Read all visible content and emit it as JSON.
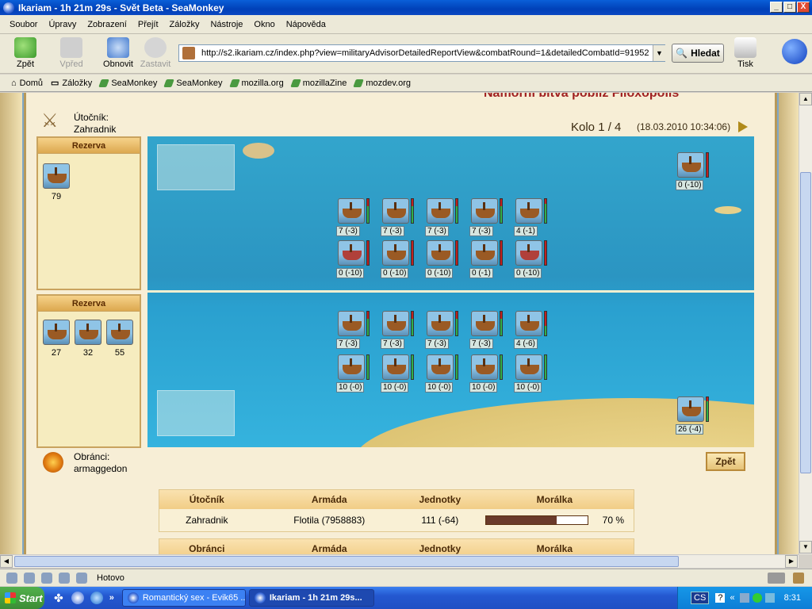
{
  "window": {
    "title": "Ikariam - 1h 21m 29s - Svět Beta - SeaMonkey",
    "buttons": {
      "minimize": "_",
      "maximize": "□",
      "close": "X"
    }
  },
  "menu": [
    "Soubor",
    "Úpravy",
    "Zobrazení",
    "Přejít",
    "Záložky",
    "Nástroje",
    "Okno",
    "Nápověda"
  ],
  "nav": {
    "back": "Zpět",
    "forward": "Vpřed",
    "reload": "Obnovit",
    "stop": "Zastavit",
    "url": "http://s2.ikariam.cz/index.php?view=militaryAdvisorDetailedReportView&combatRound=1&detailedCombatId=91952",
    "search": "Hledat",
    "print": "Tisk"
  },
  "bookmarks": [
    "Domů",
    "Záložky",
    "SeaMonkey",
    "SeaMonkey",
    "mozilla.org",
    "mozillaZine",
    "mozdev.org"
  ],
  "page": {
    "title_partial": "Námořní bitva poblíž Filoxopolis",
    "attacker_label": "Útočník:",
    "attacker_name": "Zahradnik",
    "defender_label": "Obránci:",
    "defender_name": "armaggedon",
    "round": "Kolo 1 / 4",
    "date": "(18.03.2010 10:34:06)",
    "back_button": "Zpět"
  },
  "reserves": {
    "attacker": {
      "header": "Rezerva",
      "counts": [
        "79"
      ]
    },
    "defender": {
      "header": "Rezerva",
      "counts": [
        "27",
        "32",
        "55"
      ]
    }
  },
  "battlefield": {
    "attacker_ranged": {
      "count": "0 (-10)",
      "health": 0.0
    },
    "attacker_row1": [
      {
        "label": "7 (-3)",
        "health": 0.7
      },
      {
        "label": "7 (-3)",
        "health": 0.7
      },
      {
        "label": "7 (-3)",
        "health": 0.7
      },
      {
        "label": "7 (-3)",
        "health": 0.7
      },
      {
        "label": "4 (-1)",
        "health": 0.8
      }
    ],
    "attacker_row2": [
      {
        "label": "0 (-10)",
        "health": 0.0,
        "type": "red"
      },
      {
        "label": "0 (-10)",
        "health": 0.0,
        "type": "normal"
      },
      {
        "label": "0 (-10)",
        "health": 0.0,
        "type": "normal"
      },
      {
        "label": "0 (-1)",
        "health": 0.0,
        "type": "normal"
      },
      {
        "label": "0 (-10)",
        "health": 0.0,
        "type": "red"
      }
    ],
    "defender_row1": [
      {
        "label": "7 (-3)",
        "health": 0.7
      },
      {
        "label": "7 (-3)",
        "health": 0.7
      },
      {
        "label": "7 (-3)",
        "health": 0.7
      },
      {
        "label": "7 (-3)",
        "health": 0.7
      },
      {
        "label": "4 (-6)",
        "health": 0.4
      }
    ],
    "defender_row2": [
      {
        "label": "10 (-0)",
        "health": 1.0
      },
      {
        "label": "10 (-0)",
        "health": 1.0
      },
      {
        "label": "10 (-0)",
        "health": 1.0
      },
      {
        "label": "10 (-0)",
        "health": 1.0
      },
      {
        "label": "10 (-0)",
        "health": 1.0
      }
    ],
    "defender_ranged": {
      "count": "26 (-4)",
      "health": 0.85
    }
  },
  "summary": {
    "headers": [
      "Útočník",
      "Armáda",
      "Jednotky",
      "Morálka"
    ],
    "row": {
      "player": "Zahradnik",
      "army": "Flotila (7958883)",
      "units": "111 (-64)",
      "morale_value": 0.7,
      "morale_text": "70 %"
    },
    "headers2": [
      "Obránci",
      "Armáda",
      "Jednotky",
      "Morálka"
    ]
  },
  "status": {
    "text": "Hotovo"
  },
  "taskbar": {
    "start": "Start",
    "tasks": [
      "Romantický sex - Evik65 ...",
      "Ikariam - 1h 21m 29s..."
    ],
    "lang": "CS",
    "clock": "8:31"
  },
  "colors": {
    "health_green": "#2fb04a",
    "health_red": "#c02020",
    "morale_fill": "#6a3a2a"
  }
}
